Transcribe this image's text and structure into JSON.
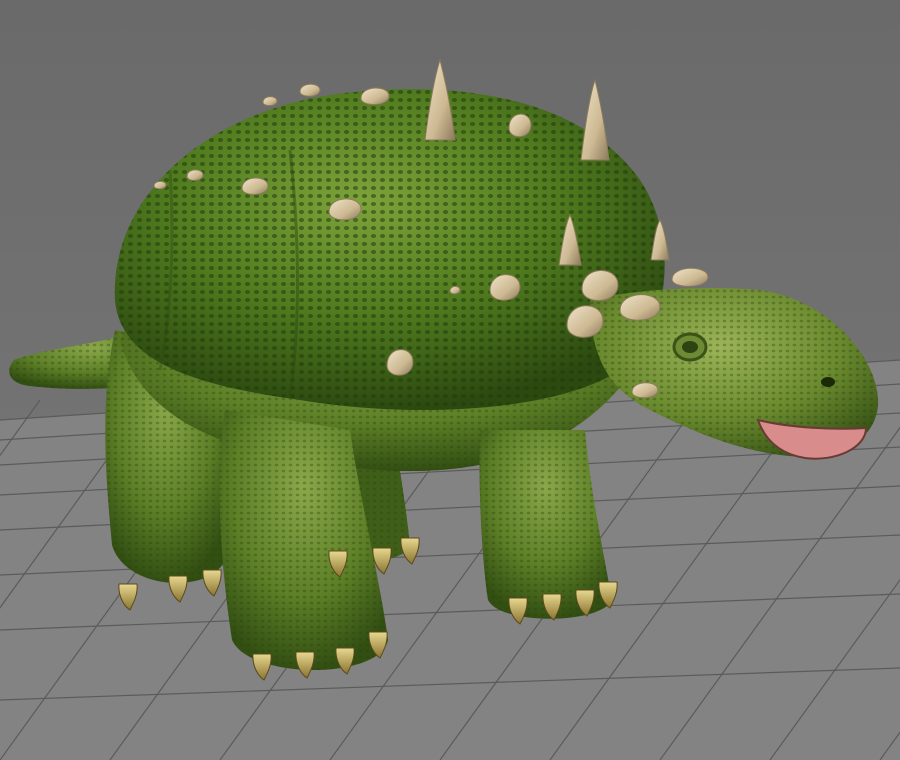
{
  "scene": {
    "subject_icon": "ankylosaur-model-icon",
    "colors": {
      "background_top": "#6a6a6a",
      "background_bottom": "#7a7a7a",
      "floor": "#838383",
      "grid_line": "#5b5b5b",
      "skin_light": "#7da33a",
      "skin_mid": "#4f7a1e",
      "skin_dark": "#2c4a10",
      "spike": "#d9c9a8",
      "spike_shadow": "#8c7a5c",
      "mouth": "#d98c8c",
      "claw": "#d8c070"
    }
  }
}
